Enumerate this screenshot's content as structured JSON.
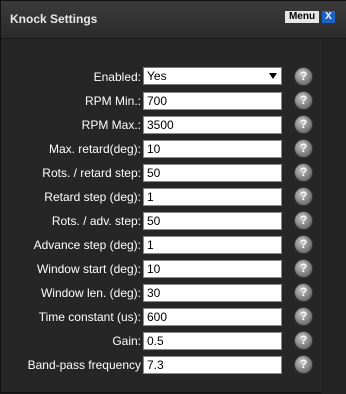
{
  "window": {
    "title": "Knock Settings",
    "menu_label": "Menu",
    "close_label": "X"
  },
  "help_glyph": "?",
  "fields": [
    {
      "label": "Enabled:",
      "value": "Yes",
      "type": "select"
    },
    {
      "label": "RPM Min.:",
      "value": "700"
    },
    {
      "label": "RPM Max.:",
      "value": "3500"
    },
    {
      "label": "Max. retard(deg):",
      "value": "10"
    },
    {
      "label": "Rots. / retard step:",
      "value": "50"
    },
    {
      "label": "Retard step (deg):",
      "value": "1"
    },
    {
      "label": "Rots. / adv. step:",
      "value": "50"
    },
    {
      "label": "Advance step (deg):",
      "value": "1"
    },
    {
      "label": "Window start (deg):",
      "value": "10"
    },
    {
      "label": "Window len. (deg):",
      "value": "30"
    },
    {
      "label": "Time constant (us):",
      "value": "600"
    },
    {
      "label": "Gain:",
      "value": "0.5"
    },
    {
      "label": "Band-pass frequency",
      "value": "7.3"
    }
  ],
  "icons": {
    "help": "help-icon",
    "close": "close-icon",
    "dropdown": "chevron-down-icon"
  }
}
